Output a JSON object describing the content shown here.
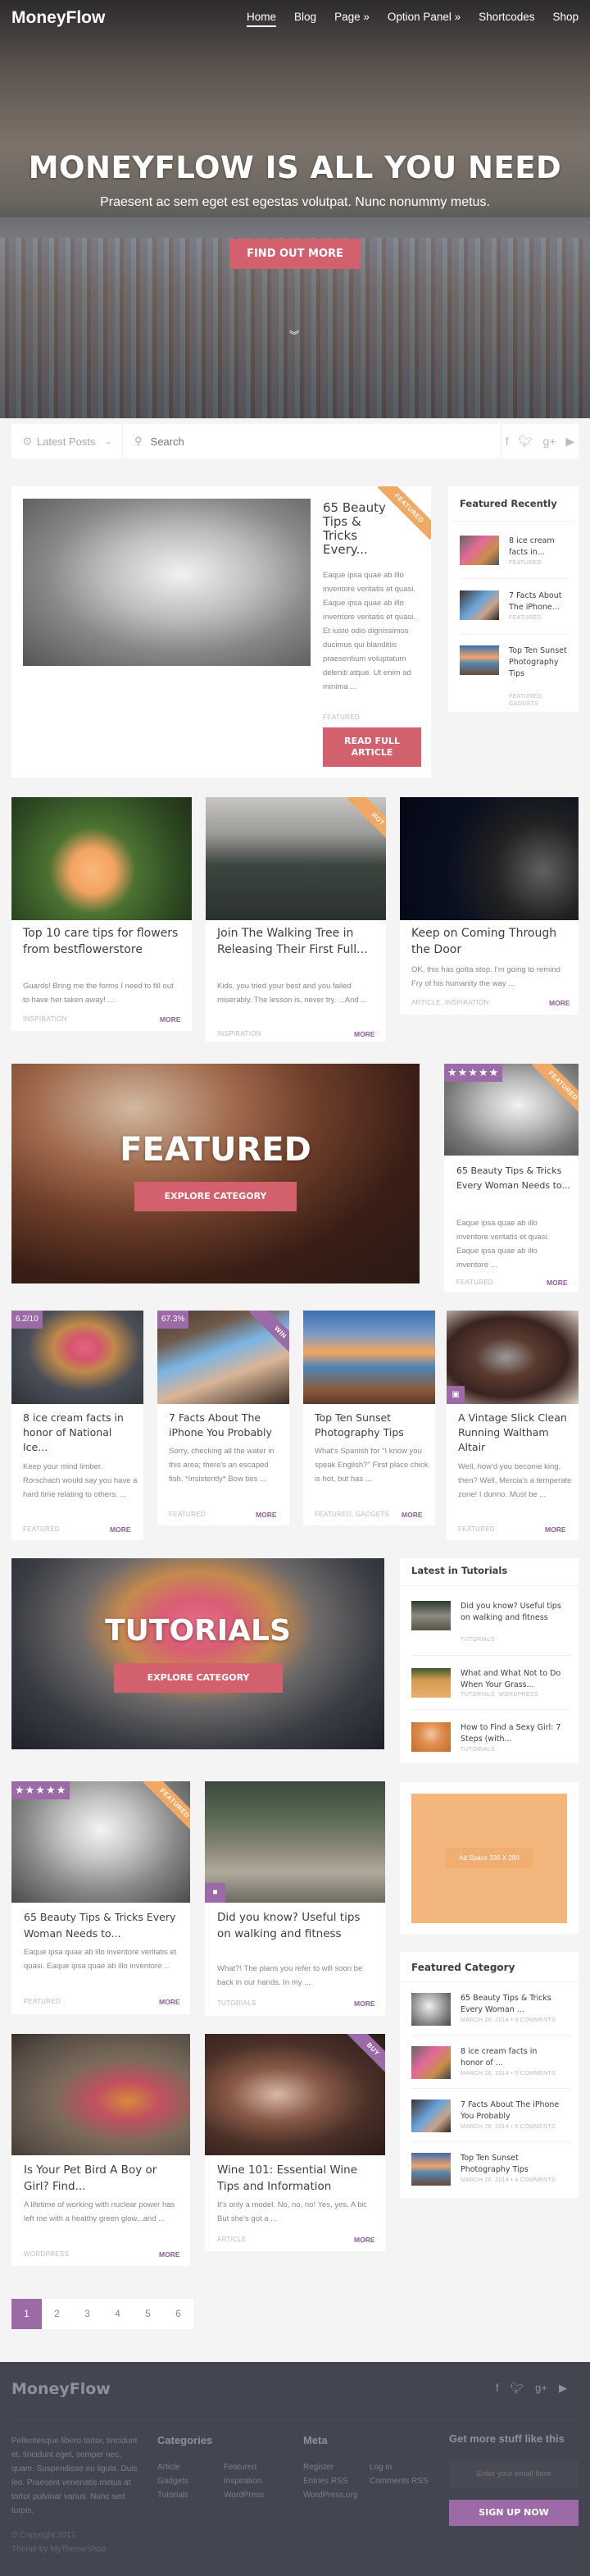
{
  "header": {
    "logo": "MoneyFlow",
    "nav": [
      "Home",
      "Blog",
      "Page »",
      "Option Panel »",
      "Shortcodes",
      "Shop"
    ],
    "active_nav": "Home"
  },
  "hero": {
    "title": "MONEYFLOW IS ALL YOU NEED",
    "subtitle": "Praesent ac sem eget est egestas volutpat. Nunc nonummy metus.",
    "button": "FIND OUT MORE"
  },
  "filterbar": {
    "dropdown": "Latest Posts",
    "search_placeholder": "Search",
    "social": [
      "facebook-icon",
      "twitter-icon",
      "google-plus-icon",
      "youtube-icon"
    ]
  },
  "featured_post": {
    "title": "65 Beauty Tips & Tricks Every...",
    "excerpt": "Eaque ipsa quae ab illo inventore veritatis et quasi. Eaque ipsa quae ab illo inventore veritatis et quasi. Et iusto odio dignissimos ducimus qui blanditiis praesentium voluptatum deleniti atque. Ut enim ad minima ...",
    "category": "FEATURED",
    "ribbon": "FEATURED",
    "button": "READ FULL ARTICLE"
  },
  "featured_recently": {
    "title": "Featured Recently",
    "items": [
      {
        "title": "8 ice cream facts in...",
        "cat": "FEATURED"
      },
      {
        "title": "7 Facts About The iPhone...",
        "cat": "FEATURED"
      },
      {
        "title": "Top Ten Sunset Photography Tips",
        "cat": "FEATURED, GADGETS"
      }
    ]
  },
  "row1": [
    {
      "title": "Top 10 care tips for flowers from bestflowerstore",
      "excerpt": "Guards! Bring me the forms I need to fill out to have her taken away! ...",
      "cat": "INSPIRATION",
      "more": "MORE"
    },
    {
      "title": "Join The Walking Tree in Releasing Their First Full...",
      "excerpt": "Kids, you tried your best and you failed miserably. The lesson is, never try. ...And ...",
      "cat": "INSPIRATION",
      "more": "MORE",
      "ribbon": "HOT"
    },
    {
      "title": "Keep on Coming Through the Door",
      "excerpt": "OK, this has gotta stop. I'm going to remind Fry of his humanity the way ...",
      "cat": "ARTICLE, INSPIRATION",
      "more": "MORE"
    }
  ],
  "featured_banner": {
    "title": "FEATURED",
    "button": "EXPLORE CATEGORY"
  },
  "featured_side_card": {
    "title": "65 Beauty Tips & Tricks Every Woman Needs to...",
    "excerpt": "Eaque ipsa quae ab illo inventore veritatis et quasi. Eaque ipsa quae ab illo inventore ...",
    "cat": "FEATURED",
    "more": "MORE",
    "ribbon": "FEATURED",
    "rating_stars": 5
  },
  "row2": [
    {
      "title": "8 ice cream facts in honor of National Ice...",
      "excerpt": "Keep your mind limber. Rorschach would say you have a hard time relating to others. ...",
      "cat": "FEATURED",
      "more": "MORE",
      "badge": "6.2/10"
    },
    {
      "title": "7 Facts About The iPhone You Probably",
      "excerpt": "Sorry, checking all the water in this area; there's an escaped fish. *Insistently* Bow ties ...",
      "cat": "FEATURED",
      "more": "MORE",
      "badge": "67.3%",
      "ribbon": "WIN"
    },
    {
      "title": "Top Ten Sunset Photography Tips",
      "excerpt": "What's Spanish for \"I know you speak English?\" First place chick is hot, but has ...",
      "cat": "FEATURED, GADGETS",
      "more": "MORE"
    },
    {
      "title": "A Vintage Slick Clean Running Waltham Altair",
      "excerpt": "Well, how'd you become king, then? Well, Mercia's a temperate zone! I dunno. Must be ...",
      "cat": "FEATURED",
      "more": "MORE"
    }
  ],
  "tutorials_banner": {
    "title": "TUTORIALS",
    "button": "EXPLORE CATEGORY"
  },
  "latest_tutorials": {
    "title": "Latest in Tutorials",
    "items": [
      {
        "title": "Did you know? Useful tips on walking and fitness",
        "cat": "TUTORIALS"
      },
      {
        "title": "What and What Not to Do When Your Grass...",
        "cat": "TUTORIALS, WORDPRESS"
      },
      {
        "title": "How to Find a Sexy Girl: 7 Steps (with...",
        "cat": "TUTORIALS"
      }
    ]
  },
  "row3": [
    {
      "title": "65 Beauty Tips & Tricks Every Woman Needs to...",
      "excerpt": "Eaque ipsa quae ab illo inventore veritatis et quasi. Eaque ipsa quae ab illo inventore ...",
      "cat": "FEATURED",
      "more": "MORE",
      "ribbon": "FEATURED",
      "rating_stars": 5
    },
    {
      "title": "Did you know? Useful tips on walking and fitness",
      "excerpt": "What?! The plans you refer to will soon be back in our hands. In my ...",
      "cat": "TUTORIALS",
      "more": "MORE"
    }
  ],
  "ad": {
    "label": "Ad Space 336 X 280"
  },
  "featured_category": {
    "title": "Featured Category",
    "items": [
      {
        "title": "65 Beauty Tips & Tricks Every Woman ...",
        "meta": "MARCH 26, 2014 • 9 COMMENTS"
      },
      {
        "title": "8 ice cream facts in honor of ...",
        "meta": "MARCH 26, 2014 • 5 COMMENTS"
      },
      {
        "title": "7 Facts About The iPhone You Probably",
        "meta": "MARCH 26, 2014 • 5 COMMENTS"
      },
      {
        "title": "Top Ten Sunset Photography Tips",
        "meta": "MARCH 26, 2014 • 4 COMMENTS"
      }
    ]
  },
  "row4": [
    {
      "title": "Is Your Pet Bird A Boy or Girl? Find...",
      "excerpt": "A lifetime of working with nuclear power has left me with a healthy green glow...and ...",
      "cat": "WORDPRESS",
      "more": "MORE"
    },
    {
      "title": "Wine 101: Essential Wine Tips and Information",
      "excerpt": "It's only a model. No, no, no! Yes, yes. A bit. But she's got a ...",
      "cat": "ARTICLE",
      "more": "MORE",
      "ribbon": "BUY"
    }
  ],
  "pagination": {
    "pages": [
      "1",
      "2",
      "3",
      "4",
      "5",
      "6"
    ],
    "current": "1"
  },
  "footer": {
    "logo": "MoneyFlow",
    "about": "Pellentesque libero tortor, tincidunt et, tincidunt eget, semper nec, quam. Suspendisse eu ligula. Duis leo. Praesent venenatis metus at tortor pulvinar varius. Nunc sed turpis.",
    "copyright": "© Copyright 2017.",
    "credit": "Theme by MyThemeShop",
    "categories_title": "Categories",
    "categories": [
      "Article",
      "Featured",
      "Gadgets",
      "Inspiration",
      "Tutorials",
      "WordPress"
    ],
    "meta_title": "Meta",
    "meta": [
      "Register",
      "Log in",
      "Entries RSS",
      "Comments RSS",
      "WordPress.org"
    ],
    "newsletter_title": "Get more stuff like this",
    "email_placeholder": "Enter your email here",
    "signup": "SIGN UP NOW"
  },
  "colors": {
    "accent_red": "#d3606d",
    "accent_purple": "#9b6aa7",
    "ribbon_orange": "#f0a964",
    "footer_bg": "#434651"
  }
}
